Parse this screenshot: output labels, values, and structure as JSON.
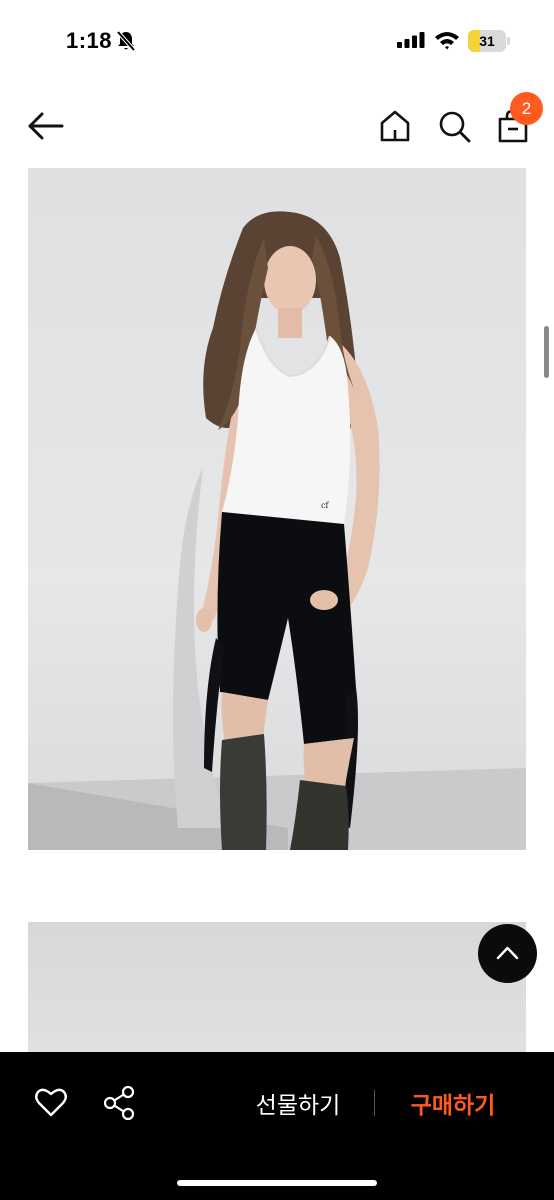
{
  "status_bar": {
    "time": "1:18",
    "battery_level": "31",
    "battery_fraction": 0.31,
    "icons": [
      "bell-slash-icon",
      "cellular-signal-icon",
      "wifi-icon",
      "battery-icon"
    ]
  },
  "header": {
    "icons": [
      "arrow-left-icon",
      "home-icon",
      "search-icon",
      "shopping-bag-icon"
    ],
    "cart_count": "2",
    "badge_color": "#ff5a1f"
  },
  "gallery": {
    "images": [
      "product-photo",
      "product-photo"
    ]
  },
  "bottom_bar": {
    "gift_label": "선물하기",
    "buy_label": "구매하기",
    "accent_color": "#ff5a1f",
    "background": "#000000",
    "icons": [
      "heart-icon",
      "share-icon",
      "chevron-up-icon"
    ]
  }
}
